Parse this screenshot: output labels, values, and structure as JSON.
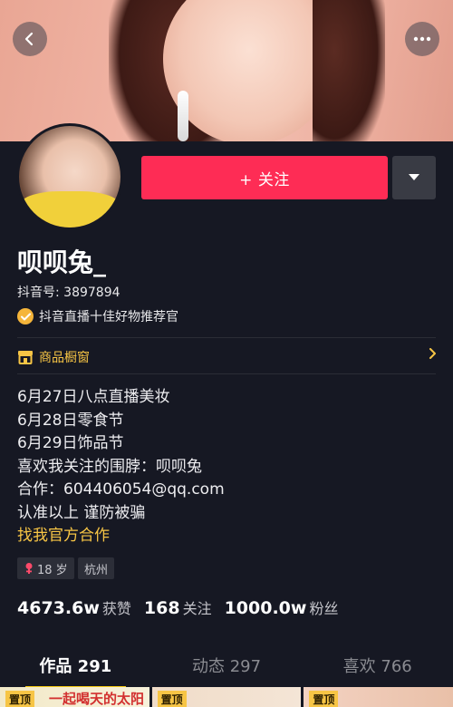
{
  "header": {
    "back_icon": "back-arrow-icon",
    "more_icon": "more-dots-icon"
  },
  "profile": {
    "follow_label": "+ 关注",
    "nickname": "呗呗兔_",
    "douyin_id": "抖音号: 3897894",
    "verification": "抖音直播十佳好物推荐官",
    "showcase_label": "商品橱窗",
    "bio_lines": [
      "6月27日八点直播美妆",
      "6月28日零食节",
      "6月29日饰品节",
      "喜欢我关注的围脖：呗呗兔",
      "合作：604406054@qq.com",
      "认准以上 谨防被骗"
    ],
    "bio_link": "找我官方合作",
    "tags": {
      "age": "18 岁",
      "city": "杭州"
    },
    "stats": [
      {
        "value": "4673.6w",
        "label": "获赞"
      },
      {
        "value": "168",
        "label": "关注"
      },
      {
        "value": "1000.0w",
        "label": "粉丝"
      }
    ]
  },
  "tabs": [
    {
      "label": "作品 291",
      "active": true
    },
    {
      "label": "动态 297",
      "active": false
    },
    {
      "label": "喜欢 766",
      "active": false
    }
  ],
  "grid": {
    "pin_label": "置顶",
    "thumb1_text": "一起喝天的太阳"
  },
  "colors": {
    "background": "#161823",
    "accent_red": "#fe2c55",
    "accent_yellow": "#f7c545"
  }
}
